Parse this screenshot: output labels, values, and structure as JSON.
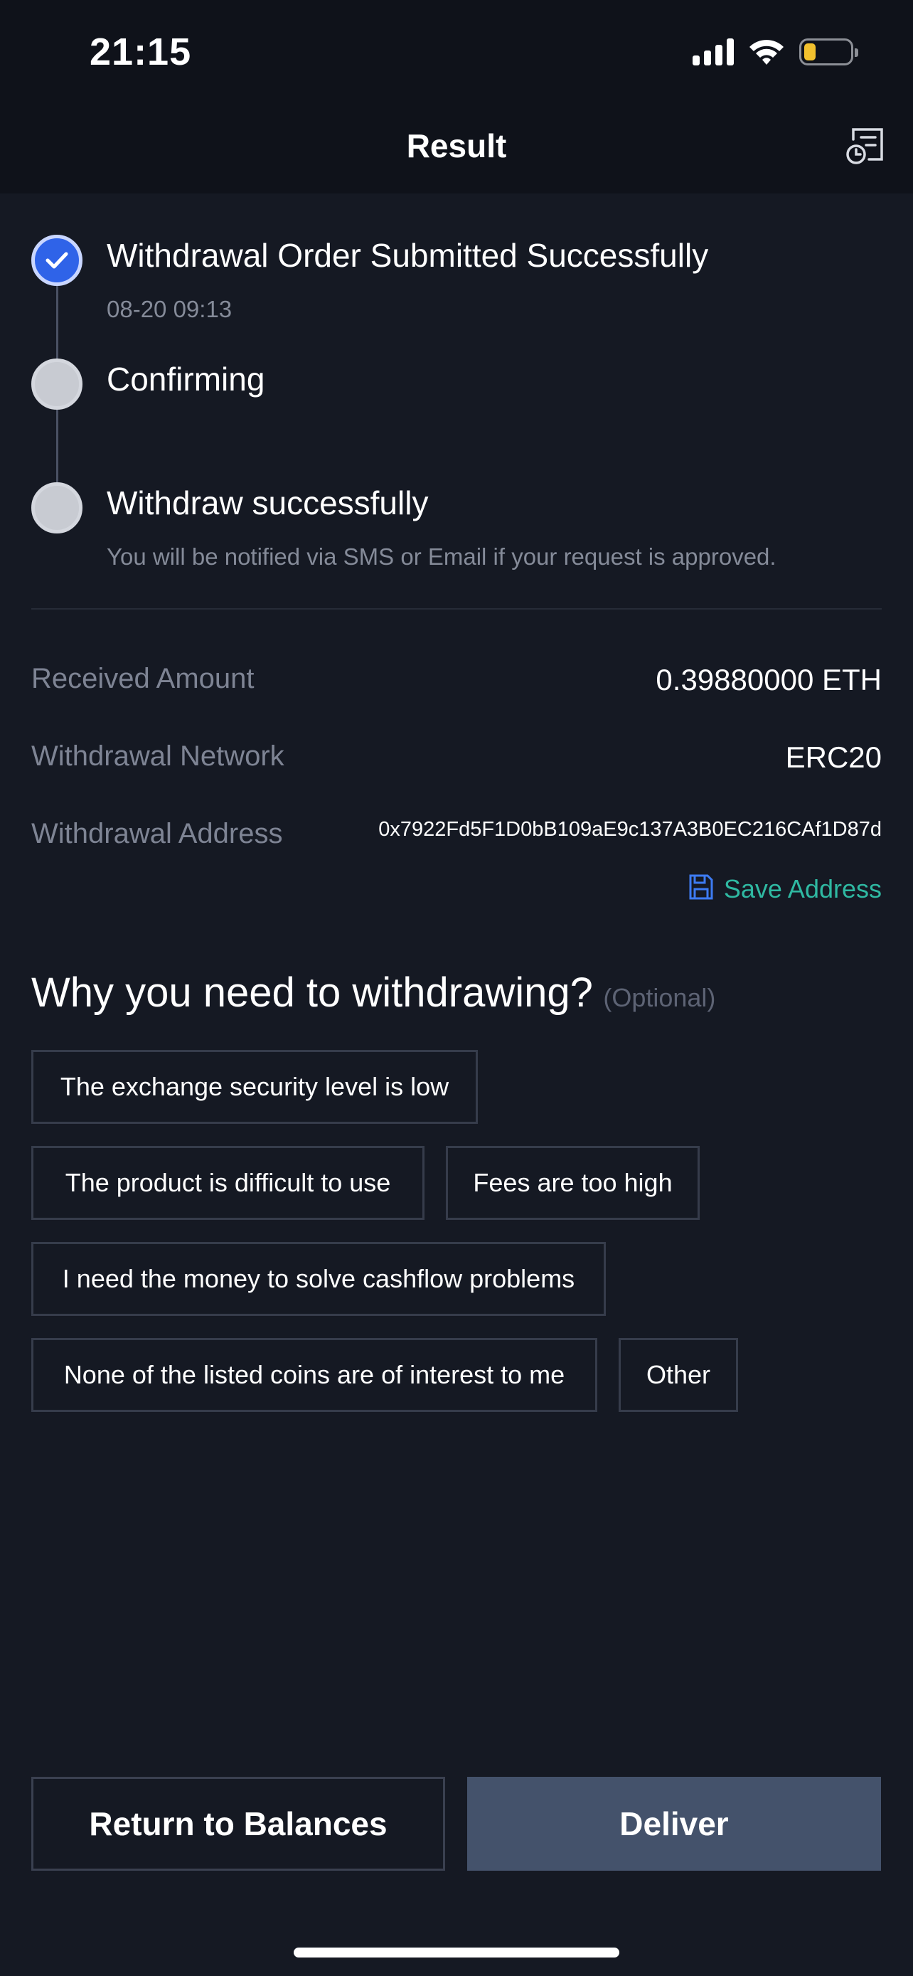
{
  "status_bar": {
    "time": "21:15"
  },
  "header": {
    "title": "Result",
    "history_icon": "order-history-icon"
  },
  "timeline": {
    "steps": [
      {
        "title": "Withdrawal Order Submitted Successfully",
        "subtitle": "08-20 09:13",
        "state": "done"
      },
      {
        "title": "Confirming",
        "subtitle": "",
        "state": "pending"
      },
      {
        "title": "Withdraw successfully",
        "subtitle": "You will be notified via SMS or Email if your request is approved.",
        "state": "pending"
      }
    ]
  },
  "details": {
    "received_amount": {
      "label": "Received Amount",
      "value": "0.39880000 ETH"
    },
    "network": {
      "label": "Withdrawal Network",
      "value": "ERC20"
    },
    "address": {
      "label": "Withdrawal Address",
      "value": "0x7922Fd5F1D0bB109aE9c137A3B0EC216CAf1D87d"
    },
    "save_address": "Save Address"
  },
  "reasons": {
    "title": "Why you need to withdrawing?",
    "optional": "(Optional)",
    "options": [
      "The exchange security level is low",
      "The product is difficult to use",
      "Fees are too high",
      "I need the money to solve cashflow problems",
      "None of the listed coins are of interest to me",
      "Other"
    ]
  },
  "buttons": {
    "return": "Return to Balances",
    "deliver": "Deliver"
  },
  "colors": {
    "accent_blue": "#2f63e8",
    "save_green": "#2fb9a2",
    "deliver_bg": "#44526b",
    "background": "#151923"
  }
}
